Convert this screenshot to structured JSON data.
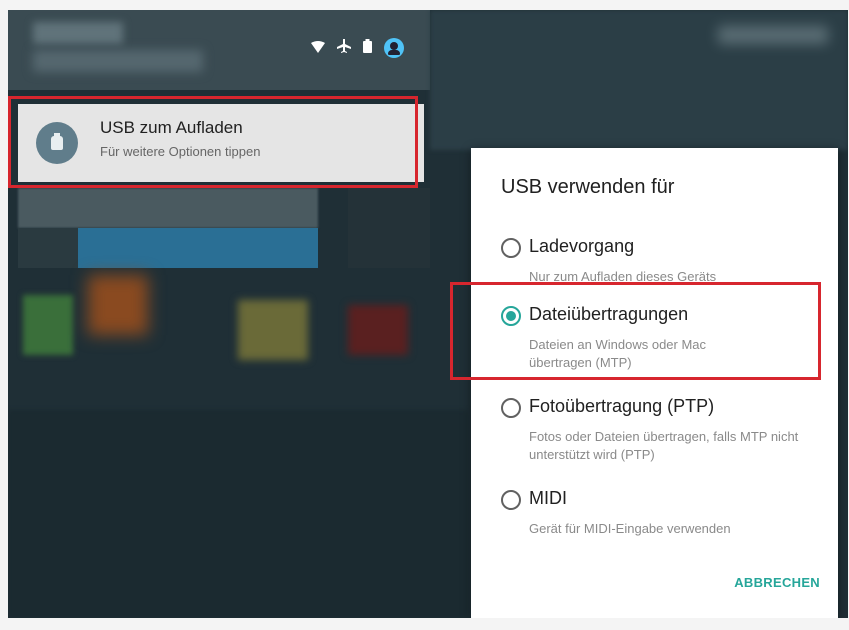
{
  "notification": {
    "title": "USB zum Aufladen",
    "subtitle": "Für weitere Optionen tippen"
  },
  "status_bar": {
    "icons": [
      "wifi-icon",
      "airplane-icon",
      "battery-icon",
      "account-icon"
    ]
  },
  "dialog": {
    "title": "USB verwenden für",
    "options": [
      {
        "label": "Ladevorgang",
        "description": "Nur zum Aufladen dieses Geräts",
        "selected": false
      },
      {
        "label": "Dateiübertragungen",
        "description": "Dateien an Windows oder Mac übertragen (MTP)",
        "selected": true
      },
      {
        "label": "Fotoübertragung (PTP)",
        "description": "Fotos oder Dateien übertragen, falls MTP nicht unterstützt wird (PTP)",
        "selected": false
      },
      {
        "label": "MIDI",
        "description": "Gerät für MIDI-Eingabe verwenden",
        "selected": false
      }
    ],
    "cancel_label": "ABBRECHEN"
  },
  "colors": {
    "accent": "#26a69a",
    "highlight": "#d7262e"
  }
}
